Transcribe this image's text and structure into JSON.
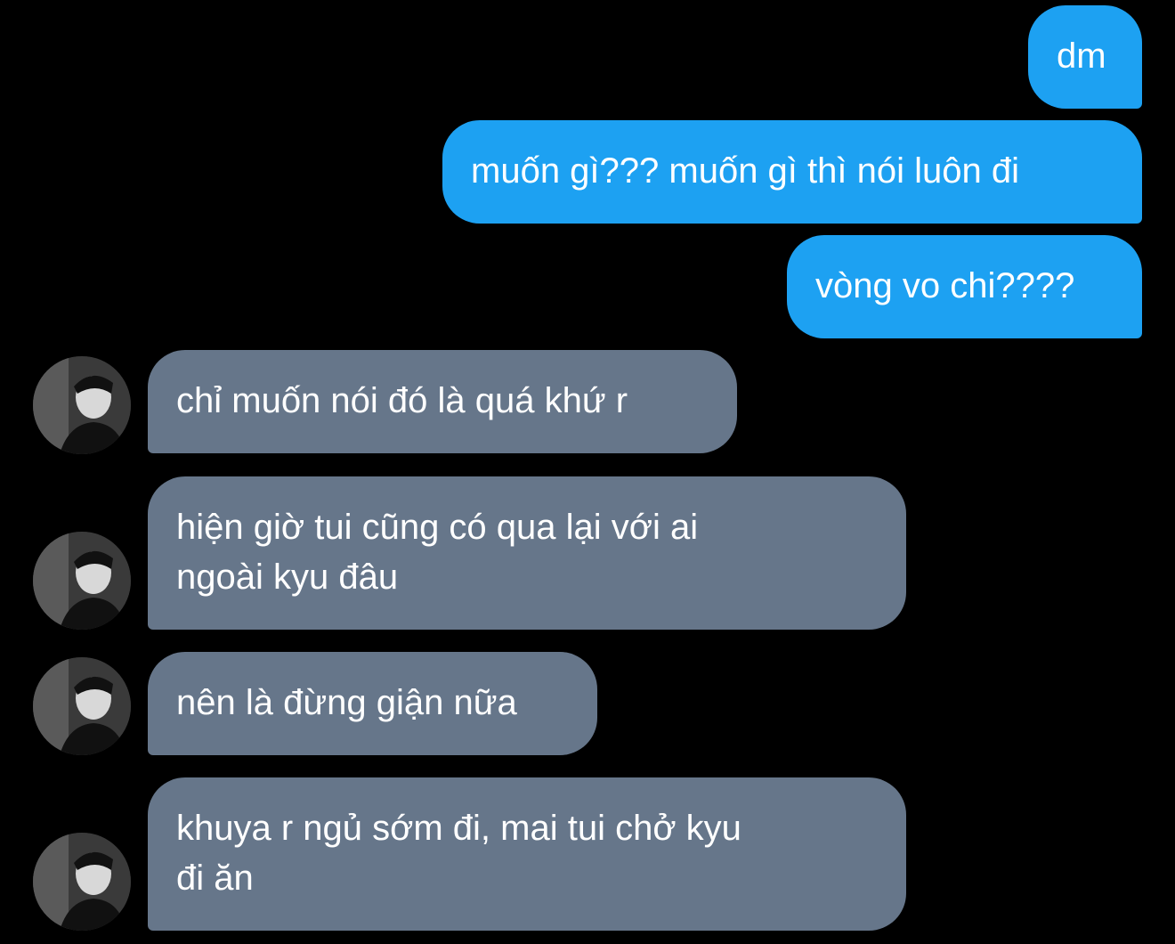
{
  "thread": {
    "sent": [
      {
        "text": "dm"
      },
      {
        "text": "muốn gì??? muốn gì thì nói luôn đi"
      },
      {
        "text": "vòng vo chi????"
      }
    ],
    "received": [
      {
        "line1": "chỉ muốn nói đó là quá khứ r",
        "line2": ""
      },
      {
        "line1": "hiện giờ tui cũng có qua lại với ai",
        "line2": "ngoài kyu đâu"
      },
      {
        "line1": "nên là đừng giận nữa",
        "line2": ""
      },
      {
        "line1": "khuya r ngủ sớm đi, mai tui chở kyu",
        "line2": "đi ăn"
      }
    ]
  },
  "colors": {
    "background": "#000000",
    "sent_bubble": "#1da1f2",
    "received_bubble": "#66768a",
    "text": "#ffffff"
  },
  "icons": {
    "sender_avatar": "grayscale-profile-photo-avatar"
  }
}
